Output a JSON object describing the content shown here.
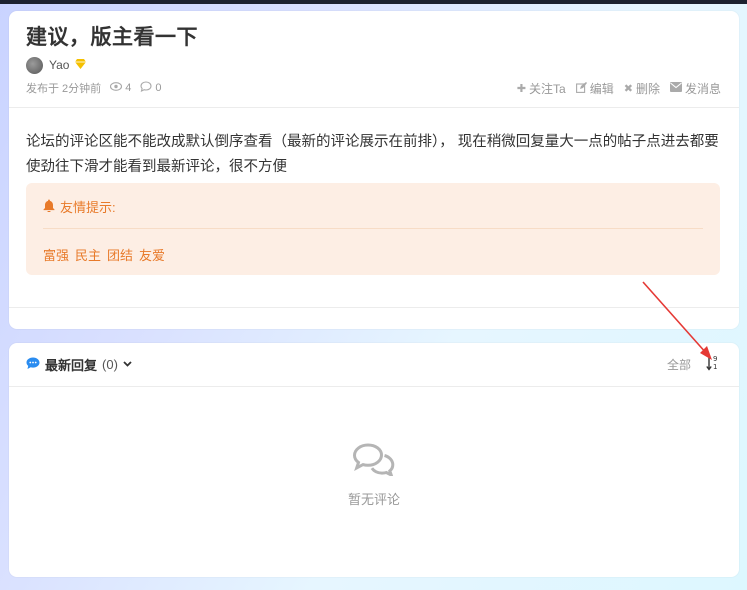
{
  "post": {
    "title": "建议，版主看一下",
    "author": "Yao",
    "published": "发布于 2分钟前",
    "views": "4",
    "comments": "0",
    "actions": {
      "follow": "关注Ta",
      "edit": "编辑",
      "delete": "删除",
      "message": "发消息"
    },
    "body": "论坛的评论区能不能改成默认倒序查看（最新的评论展示在前排）， 现在稍微回复量大一点的帖子点进去都要使劲往下滑才能看到最新评论，很不方便",
    "notice": {
      "title": "友情提示:",
      "tags": [
        "富强",
        "民主",
        "团结",
        "友爱"
      ]
    }
  },
  "comments_section": {
    "title": "最新回复",
    "count": "(0)",
    "filter": "全部",
    "sort_icon": "sort-numeric-desc-icon",
    "empty_text": "暂无评论"
  },
  "colors": {
    "accent_orange": "#e87a2a",
    "notice_bg": "#fdeee4",
    "link_blue": "#2a8cf0",
    "annotation_red": "#e53935"
  }
}
